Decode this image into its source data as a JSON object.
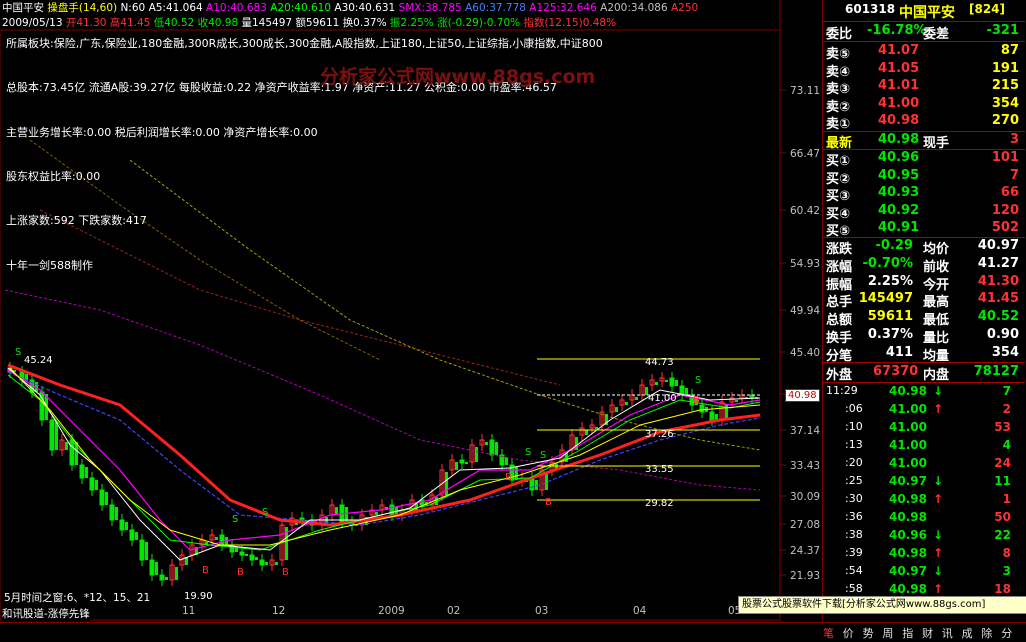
{
  "header": {
    "line1": {
      "stock": "中国平安",
      "indicator": "操盘手(14,60)",
      "n": "N:60",
      "a5": "A5:41.064",
      "a10": "A10:40.683",
      "a20": "A20:40.610",
      "a30": "A30:40.631",
      "smx": "SMX:38.785",
      "a60": "A60:37.778",
      "a125": "A125:32.646",
      "a200": "A200:34.086",
      "a250": "A250"
    },
    "line2": {
      "date": "2009/05/13",
      "open": "开41.30",
      "high": "高41.45",
      "low": "低40.52",
      "close": "收40.98",
      "volume": "量145497",
      "amount": "额59611",
      "turnover": "换0.37%",
      "amplitude": "振2.25%",
      "change": "涨(-0.29)-0.70%",
      "index": "指数(12.15)0.48%"
    }
  },
  "info_lines": [
    "所属板块:保险,广东,保险业,180金融,300R成长,300成长,300金融,A股指数,上证180,上证50,上证综指,小康指数,中证800",
    "总股本:73.45亿  流通A股:39.27亿  每股收益:0.22  净资产收益率:1.97  净资产:11.27  公积金:0.00  市盈率:46.57",
    "主营业务增长率:0.00  税后利润增长率:0.00  净资产增长率:0.00",
    "股东权益比率:0.00",
    "上涨家数:592   下跌家数:417",
    "十年一剑588制作"
  ],
  "watermark": "分析家公式网www.88gs.com",
  "y_axis": [
    "73.11",
    "66.47",
    "60.42",
    "54.93",
    "49.94",
    "45.40",
    "41.27",
    "37.14",
    "33.43",
    "30.09",
    "27.08",
    "24.37",
    "21.93"
  ],
  "current_price_tag": "40.98",
  "x_axis": [
    "11",
    "12",
    "2009",
    "02",
    "03",
    "04",
    "05"
  ],
  "chart_labels": {
    "high_mark": "45.24",
    "low_mark": "19.90",
    "fib_levels": [
      "44.73",
      "41.00",
      "37.26",
      "33.55",
      "29.82"
    ],
    "time_window": "5月时间之窗:6、*12、15、21",
    "bottom_caption": "和讯股道-涨停先锋"
  },
  "quote": {
    "code": "601318",
    "name": "中国平安",
    "num": "[824]",
    "weibi_label": "委比",
    "weibi": "-16.78%",
    "weicha_label": "委差",
    "weicha": "-321",
    "sells": [
      {
        "label": "卖⑤",
        "price": "41.07",
        "vol": "87"
      },
      {
        "label": "卖④",
        "price": "41.05",
        "vol": "191"
      },
      {
        "label": "卖③",
        "price": "41.01",
        "vol": "215"
      },
      {
        "label": "卖②",
        "price": "41.00",
        "vol": "354"
      },
      {
        "label": "卖①",
        "price": "40.98",
        "vol": "270"
      }
    ],
    "latest_label": "最新",
    "latest": "40.98",
    "xianshou_label": "现手",
    "xianshou": "3",
    "buys": [
      {
        "label": "买①",
        "price": "40.96",
        "vol": "101"
      },
      {
        "label": "买②",
        "price": "40.95",
        "vol": "7"
      },
      {
        "label": "买③",
        "price": "40.93",
        "vol": "66"
      },
      {
        "label": "买④",
        "price": "40.92",
        "vol": "120"
      },
      {
        "label": "买⑤",
        "price": "40.91",
        "vol": "502"
      }
    ],
    "stats": [
      {
        "l1": "涨跌",
        "v1": "-0.29",
        "l2": "均价",
        "v2": "40.97"
      },
      {
        "l1": "涨幅",
        "v1": "-0.70%",
        "l2": "前收",
        "v2": "41.27"
      },
      {
        "l1": "振幅",
        "v1": "2.25%",
        "l2": "今开",
        "v2": "41.30"
      },
      {
        "l1": "总手",
        "v1": "145497",
        "l2": "最高",
        "v2": "41.45"
      },
      {
        "l1": "总额",
        "v1": "59611",
        "l2": "最低",
        "v2": "40.52"
      },
      {
        "l1": "换手",
        "v1": "0.37%",
        "l2": "量比",
        "v2": "0.90"
      },
      {
        "l1": "分笔",
        "v1": "411",
        "l2": "均量",
        "v2": "354"
      }
    ],
    "waipan_label": "外盘",
    "waipan": "67370",
    "neipan_label": "内盘",
    "neipan": "78127"
  },
  "ticks": [
    {
      "time": "11:29",
      "price": "40.98",
      "arrow": "↓",
      "vol": "7",
      "up": false
    },
    {
      "time": ":06",
      "price": "41.00",
      "arrow": "↑",
      "vol": "2",
      "up": true
    },
    {
      "time": ":10",
      "price": "41.00",
      "arrow": "",
      "vol": "53",
      "up": true
    },
    {
      "time": ":13",
      "price": "41.00",
      "arrow": "",
      "vol": "4",
      "up": false
    },
    {
      "time": ":20",
      "price": "41.00",
      "arrow": "",
      "vol": "24",
      "up": true
    },
    {
      "time": ":25",
      "price": "40.97",
      "arrow": "↓",
      "vol": "11",
      "up": false
    },
    {
      "time": ":30",
      "price": "40.98",
      "arrow": "↑",
      "vol": "1",
      "up": true
    },
    {
      "time": ":36",
      "price": "40.98",
      "arrow": "",
      "vol": "50",
      "up": true
    },
    {
      "time": ":38",
      "price": "40.96",
      "arrow": "↓",
      "vol": "22",
      "up": false
    },
    {
      "time": ":39",
      "price": "40.98",
      "arrow": "↑",
      "vol": "8",
      "up": true
    },
    {
      "time": ":54",
      "price": "40.97",
      "arrow": "↓",
      "vol": "3",
      "up": false
    },
    {
      "time": ":58",
      "price": "40.98",
      "arrow": "↑",
      "vol": "18",
      "up": true
    }
  ],
  "banner": "股票公式股票软件下载[分析家公式网www.88gs.com]",
  "bottom_tabs": [
    "笔",
    "价",
    "势",
    "周",
    "指",
    "财",
    "讯",
    "成",
    "除",
    "分"
  ],
  "colors": {
    "up": "#ff3232",
    "down": "#00e600",
    "ma_red": "#ff2020",
    "ma_white": "#ffffff",
    "ma_yellow": "#ffff00",
    "ma_magenta": "#ff00ff",
    "ma_green": "#00ff00",
    "ma_blue": "#4040ff"
  }
}
